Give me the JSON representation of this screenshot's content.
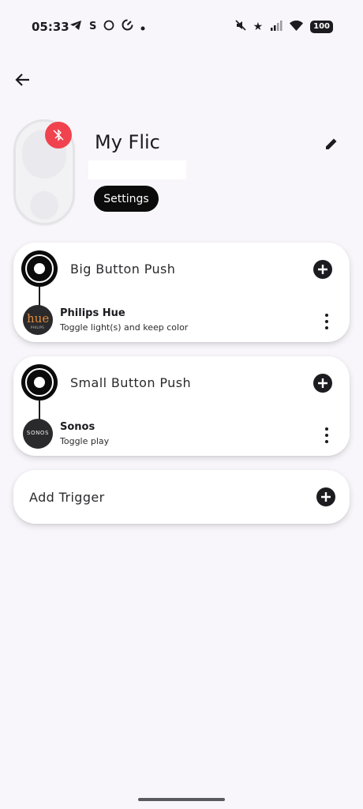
{
  "status_bar": {
    "time": "05:33",
    "left_icons": [
      "telegram-icon",
      "s-icon",
      "circle-icon",
      "sync-icon",
      "dot-icon"
    ],
    "right_icons": [
      "mute-icon",
      "star-icon",
      "signal-icon",
      "wifi-icon",
      "battery-icon"
    ],
    "battery": "100"
  },
  "header": {
    "title": "My Flic",
    "settings_label": "Settings"
  },
  "triggers": [
    {
      "label": "Big Button Push",
      "action": {
        "name": "Philips Hue",
        "description": "Toggle light(s) and keep color",
        "logo_text": "hue",
        "logo_sub": "PHILIPS"
      }
    },
    {
      "label": "Small Button Push",
      "action": {
        "name": "Sonos",
        "description": "Toggle play",
        "logo_text": "SONOS"
      }
    }
  ],
  "add_trigger_label": "Add Trigger",
  "colors": {
    "background": "#f8f6fa",
    "accent_dark": "#0b0b0c",
    "badge_red": "#f0434f",
    "card": "#ffffff"
  }
}
